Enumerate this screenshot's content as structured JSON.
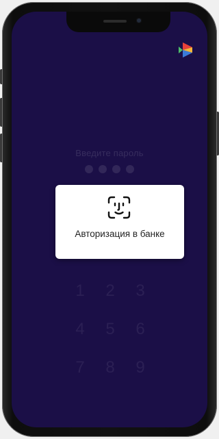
{
  "lock": {
    "prompt": "Введите пароль",
    "pin_length": 4
  },
  "keypad": {
    "keys": [
      "1",
      "2",
      "3",
      "4",
      "5",
      "6",
      "7",
      "8",
      "9"
    ]
  },
  "dialog": {
    "icon": "face-id-icon",
    "label": "Авторизация в банке"
  },
  "colors": {
    "background": "#1b0f47",
    "dialog": "#ffffff",
    "logo_red": "#e8413a",
    "logo_blue": "#3b7bd8",
    "logo_green": "#4fbf6a",
    "logo_yellow": "#f4b73a"
  }
}
